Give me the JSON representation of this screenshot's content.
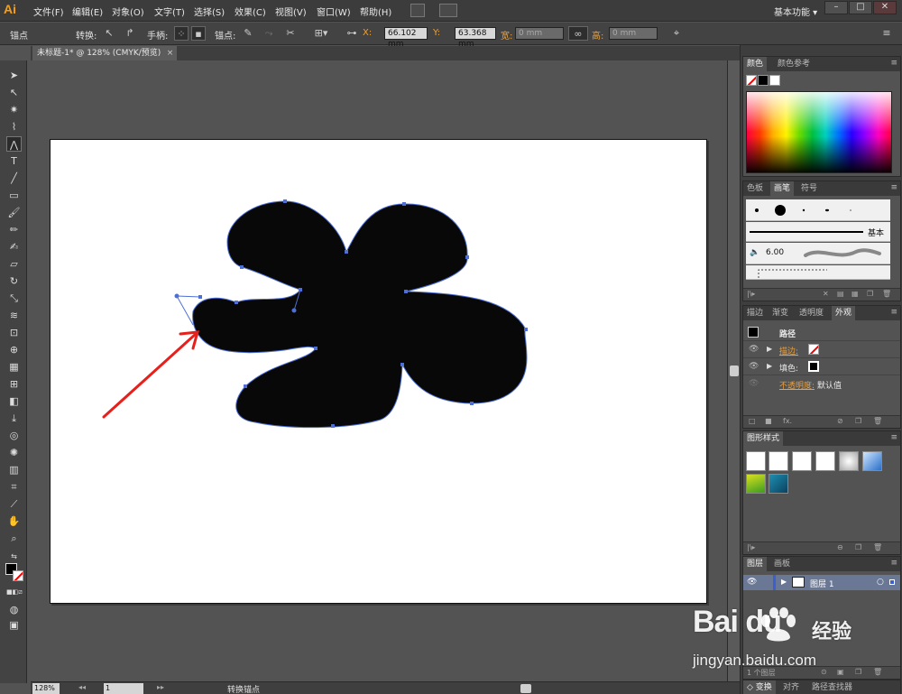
{
  "app": {
    "logo": "Ai",
    "menu": [
      "文件(F)",
      "编辑(E)",
      "对象(O)",
      "文字(T)",
      "选择(S)",
      "效果(C)",
      "视图(V)",
      "窗口(W)",
      "帮助(H)"
    ],
    "workspace": "基本功能",
    "window_buttons": [
      "–",
      "□",
      "✕"
    ]
  },
  "control_bar": {
    "selection_label": "锚点",
    "convert_label": "转换:",
    "handles_label": "手柄:",
    "anchor_label": "锚点:",
    "x_label": "X:",
    "x_value": "66.102 mm",
    "y_label": "Y:",
    "y_value": "63.368 mm",
    "w_label": "宽:",
    "w_value": "0 mm",
    "h_label": "高:",
    "h_value": "0 mm"
  },
  "document": {
    "tab_title": "未标题-1* @ 128% (CMYK/预览)",
    "tab_close": "×"
  },
  "status": {
    "zoom": "128%",
    "page": "1",
    "text": "转换锚点"
  },
  "panels": {
    "color": {
      "tabs": [
        "颜色",
        "颜色参考"
      ]
    },
    "brushes": {
      "tabs": [
        "色板",
        "画笔",
        "符号"
      ],
      "basic_label": "基本",
      "size_value": "6.00"
    },
    "appearance": {
      "tabs": [
        "描边",
        "渐变",
        "透明度",
        "外观"
      ],
      "object_type": "路径",
      "rows": [
        {
          "name": "描边:",
          "value": ""
        },
        {
          "name": "填色:",
          "value": ""
        },
        {
          "name": "不透明度:",
          "value": "默认值"
        }
      ],
      "footer_fx": "fx."
    },
    "graphic_styles": {
      "tabs": [
        "图形样式"
      ]
    },
    "layers": {
      "tabs": [
        "图层",
        "画板"
      ],
      "layer_name": "图层 1",
      "footer_count": "1 个图层"
    },
    "bottom": {
      "tabs": [
        "变换",
        "对齐",
        "路径查找器"
      ]
    }
  },
  "watermark": {
    "brand": "Bai  du",
    "product": "经验",
    "url": "jingyan.baidu.com"
  },
  "colors": {
    "ui_dark": "#3c3c3c",
    "canvas_bg": "#535353",
    "shape_fill": "#080808",
    "path_outline": "#4d6fd6",
    "arrow": "#e8201c",
    "accent_orange": "#e8a040"
  }
}
